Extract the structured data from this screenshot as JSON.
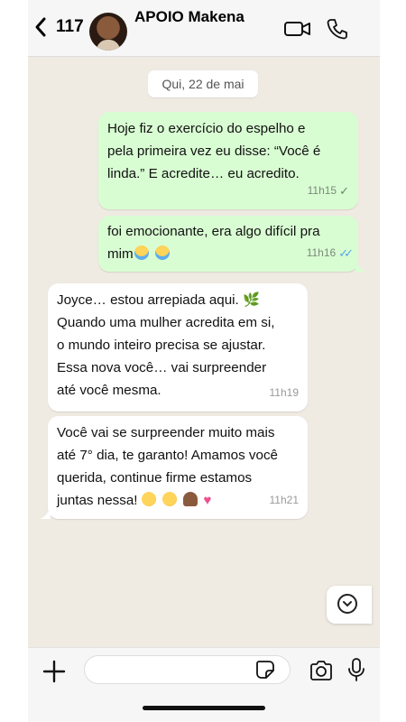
{
  "header": {
    "unread_count": "117",
    "contact_name": "APOIO Makena"
  },
  "chat": {
    "date_chip": "Qui, 22 de mai",
    "messages": [
      {
        "direction": "out",
        "text": "Hoje fiz o exercício do espelho e\npela primeira vez eu disse: “Você é\nlinda.” E acredite… eu acredito.",
        "time": "11h15",
        "status": "delivered"
      },
      {
        "direction": "out",
        "text": "foi emocionante, era algo difícil pra\nmim",
        "emojis": [
          "loudly-crying-face",
          "loudly-crying-face"
        ],
        "time": "11h16",
        "status": "read"
      },
      {
        "direction": "in",
        "text": "Joyce… estou arrepiada aqui. 🌿\nQuando uma mulher acredita em si,\no mundo inteiro precisa se ajustar.\nEssa nova você… vai surpreender\naté você mesma.",
        "time": "11h19"
      },
      {
        "direction": "in",
        "text": "Você vai se surpreender muito mais\naté 7° dia, te garanto! Amamos você\nquerida, continue firme estamos\njuntas nessa!",
        "emojis": [
          "face-blowing-kiss",
          "face-blowing-kiss",
          "folded-hands",
          "two-hearts"
        ],
        "time": "11h21"
      }
    ]
  },
  "composer": {
    "placeholder": ""
  },
  "colors": {
    "outgoing_bubble": "#d9fdd3",
    "incoming_bubble": "#ffffff",
    "chat_background": "#efeae2",
    "read_tick": "#53a6e8"
  },
  "icons": [
    "back-chevron-icon",
    "video-call-icon",
    "phone-call-icon",
    "scroll-down-icon",
    "plus-icon",
    "sticker-icon",
    "camera-icon",
    "microphone-icon"
  ]
}
